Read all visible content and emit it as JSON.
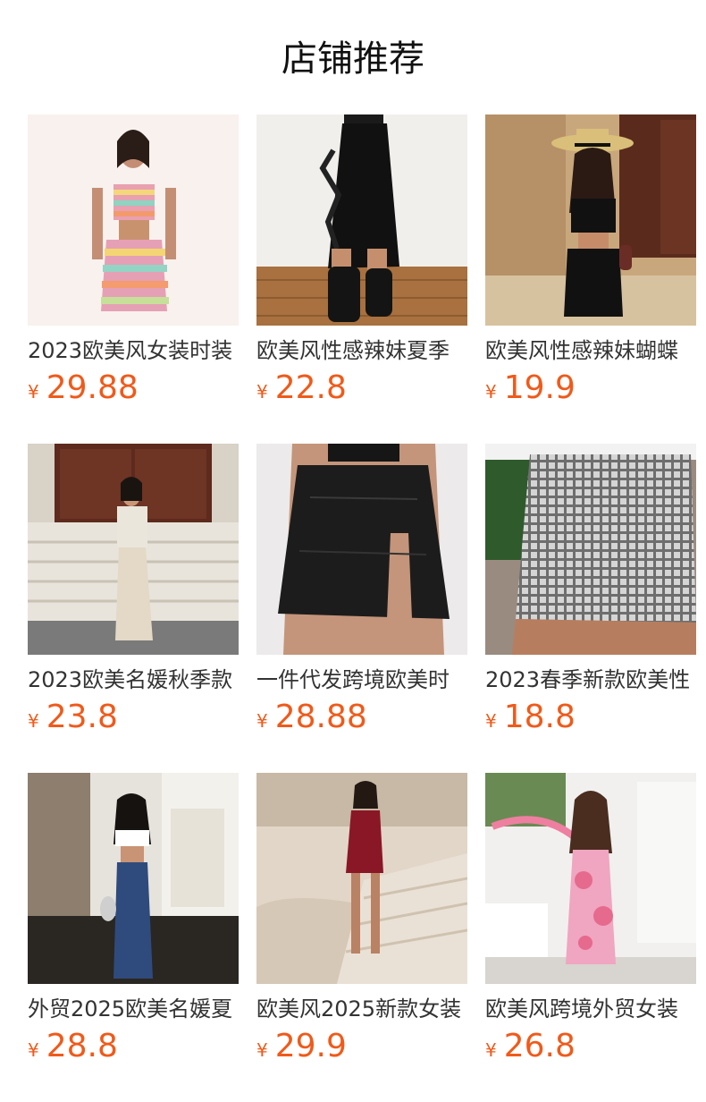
{
  "title": "店铺推荐",
  "currency": "¥",
  "products": [
    {
      "name": "2023欧美风女装时装",
      "price": "29.88"
    },
    {
      "name": "欧美风性感辣妹夏季",
      "price": "22.8"
    },
    {
      "name": "欧美风性感辣妹蝴蝶",
      "price": "19.9"
    },
    {
      "name": "2023欧美名媛秋季款",
      "price": "23.8"
    },
    {
      "name": "一件代发跨境欧美时",
      "price": "28.88"
    },
    {
      "name": "2023春季新款欧美性",
      "price": "18.8"
    },
    {
      "name": "外贸2025欧美名媛夏",
      "price": "28.8"
    },
    {
      "name": "欧美风2025新款女装",
      "price": "29.9"
    },
    {
      "name": "欧美风跨境外贸女装",
      "price": "26.8"
    }
  ]
}
